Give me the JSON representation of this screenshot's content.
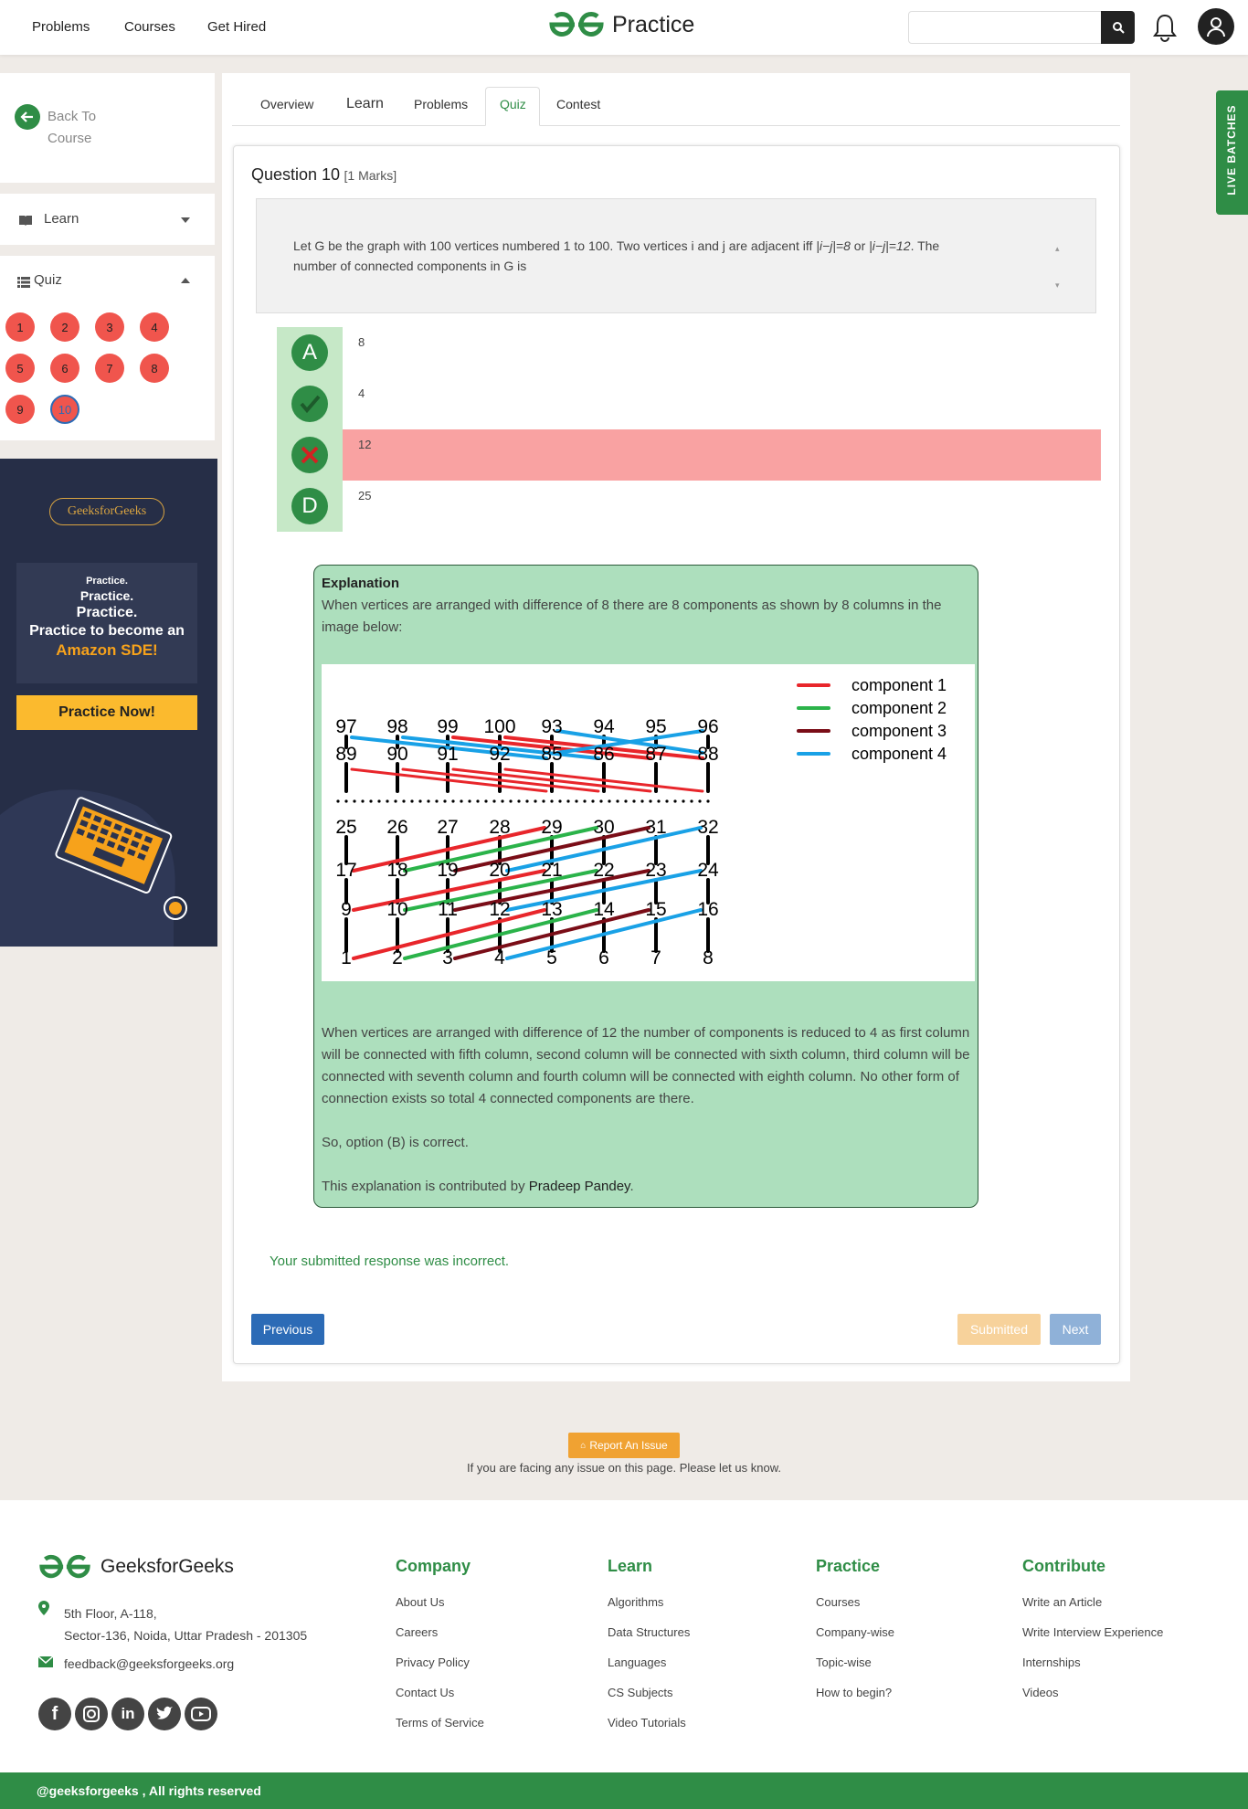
{
  "header": {
    "nav": [
      "Problems",
      "Courses",
      "Get Hired"
    ],
    "brand": "Practice",
    "search_placeholder": ""
  },
  "sidebar": {
    "back_label_line1": "Back To",
    "back_label_line2": "Course",
    "learn_label": "Learn",
    "quiz_label": "Quiz",
    "quiz_numbers": [
      "1",
      "2",
      "3",
      "4",
      "5",
      "6",
      "7",
      "8",
      "9",
      "10"
    ],
    "active_question": "10"
  },
  "ad": {
    "pill": "GeeksforGeeks",
    "line1": "Practice.",
    "line2": "Practice.",
    "line3": "Practice.",
    "line4": "Practice to become an",
    "line5": "Amazon SDE!",
    "cta": "Practice Now!"
  },
  "tabs": [
    "Overview",
    "Learn",
    "Problems",
    "Quiz",
    "Contest"
  ],
  "active_tab": "Quiz",
  "question": {
    "title": "Question 10",
    "marks": "[1 Marks]",
    "text_part1": "Let G be the graph with 100 vertices numbered 1 to 100. Two vertices i and j are adjacent iff ",
    "text_italic1": "|i−j|=8",
    "text_part2": " or ",
    "text_italic2": "|i−j|=12",
    "text_part3": ". The",
    "text_line2": "number of connected components in G is"
  },
  "options": [
    {
      "badge": "A",
      "text": "8",
      "state": "normal"
    },
    {
      "badge": "✓",
      "text": "4",
      "state": "correct"
    },
    {
      "badge": "✗",
      "text": "12",
      "state": "wrong"
    },
    {
      "badge": "D",
      "text": "25",
      "state": "normal"
    }
  ],
  "explanation": {
    "heading": "Explanation",
    "para1": "When vertices are arranged with difference of 8 there are 8 components as shown by 8 columns in the image below:",
    "para2": "When vertices are arranged with difference of 12 the number of components is reduced to 4 as first column will be connected with fifth column, second column will be connected with sixth column, third column will be connected with seventh column and fourth column will be connected with eighth column. No other form of connection exists so total 4 connected components are there.",
    "para3": "So, option (B) is correct.",
    "contrib_prefix": "This explanation is contributed by ",
    "contributor": "Pradeep Pandey",
    "contrib_suffix": "."
  },
  "diagram": {
    "legend": [
      {
        "label": "component 1",
        "color": "#e8262b"
      },
      {
        "label": "component 2",
        "color": "#2bb34a"
      },
      {
        "label": "component 3",
        "color": "#7a0d17"
      },
      {
        "label": "component 4",
        "color": "#19a1e6"
      }
    ],
    "rows": [
      [
        "97",
        "98",
        "99",
        "100",
        "93",
        "94",
        "95",
        "96"
      ],
      [
        "89",
        "90",
        "91",
        "92",
        "85",
        "86",
        "87",
        "88"
      ],
      [
        "25",
        "26",
        "27",
        "28",
        "29",
        "30",
        "31",
        "32"
      ],
      [
        "17",
        "18",
        "19",
        "20",
        "21",
        "22",
        "23",
        "24"
      ],
      [
        "9",
        "10",
        "11",
        "12",
        "13",
        "14",
        "15",
        "16"
      ],
      [
        "1",
        "2",
        "3",
        "4",
        "5",
        "6",
        "7",
        "8"
      ]
    ]
  },
  "status": "Your submitted response was incorrect.",
  "buttons": {
    "previous": "Previous",
    "submitted": "Submitted",
    "next": "Next"
  },
  "report": {
    "button": "Report An Issue",
    "note": "If you are facing any issue on this page. Please let us know."
  },
  "footer": {
    "brand": "GeeksforGeeks",
    "address1": "5th Floor, A-118,",
    "address2": "Sector-136, Noida, Uttar Pradesh - 201305",
    "email": "feedback@geeksforgeeks.org",
    "columns": [
      {
        "title": "Company",
        "links": [
          "About Us",
          "Careers",
          "Privacy Policy",
          "Contact Us",
          "Terms of Service"
        ]
      },
      {
        "title": "Learn",
        "links": [
          "Algorithms",
          "Data Structures",
          "Languages",
          "CS Subjects",
          "Video Tutorials"
        ]
      },
      {
        "title": "Practice",
        "links": [
          "Courses",
          "Company-wise",
          "Topic-wise",
          "How to begin?"
        ]
      },
      {
        "title": "Contribute",
        "links": [
          "Write an Article",
          "Write Interview Experience",
          "Internships",
          "Videos"
        ]
      }
    ],
    "copyright": "@geeksforgeeks , All rights reserved"
  },
  "live_batches": "LIVE BATCHES",
  "colors": {
    "brand_green": "#2f8d46",
    "wrong_row": "#f9a2a2",
    "quiz_circle": "#f0554d"
  }
}
